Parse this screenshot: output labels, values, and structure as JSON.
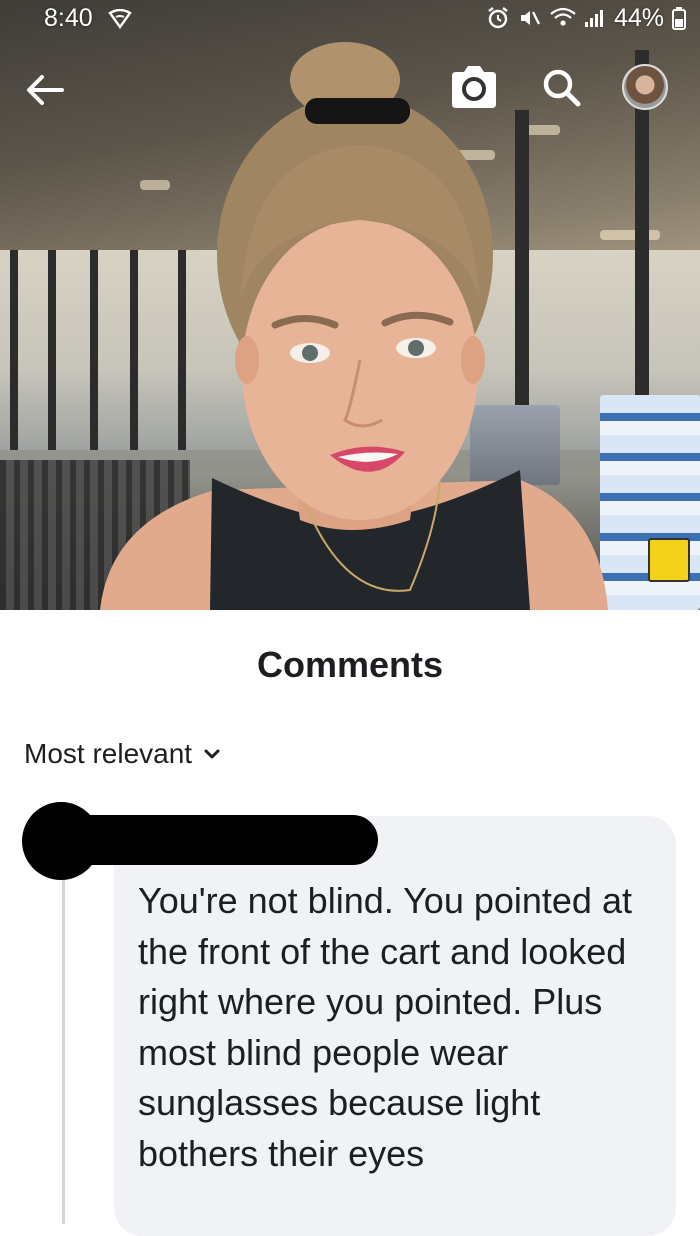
{
  "status_bar": {
    "time": "8:40",
    "battery": "44%",
    "icons": [
      "wifi-shield-icon",
      "alarm-icon",
      "mute-icon",
      "wifi-icon",
      "signal-icon",
      "battery-icon"
    ]
  },
  "video_overlay": {
    "icons": [
      "back-arrow-icon",
      "camera-icon",
      "search-icon",
      "profile-avatar"
    ]
  },
  "comments": {
    "title": "Comments",
    "sort_label": "Most relevant",
    "items": [
      {
        "author": "",
        "text": "You're not blind.  You pointed at the front of the cart and looked right where you pointed.  Plus most blind people wear sunglasses because light bothers their eyes"
      }
    ]
  },
  "colors": {
    "sheet_bg": "#ffffff",
    "bubble_bg": "#f0f2f5",
    "text": "#1c1e21"
  }
}
